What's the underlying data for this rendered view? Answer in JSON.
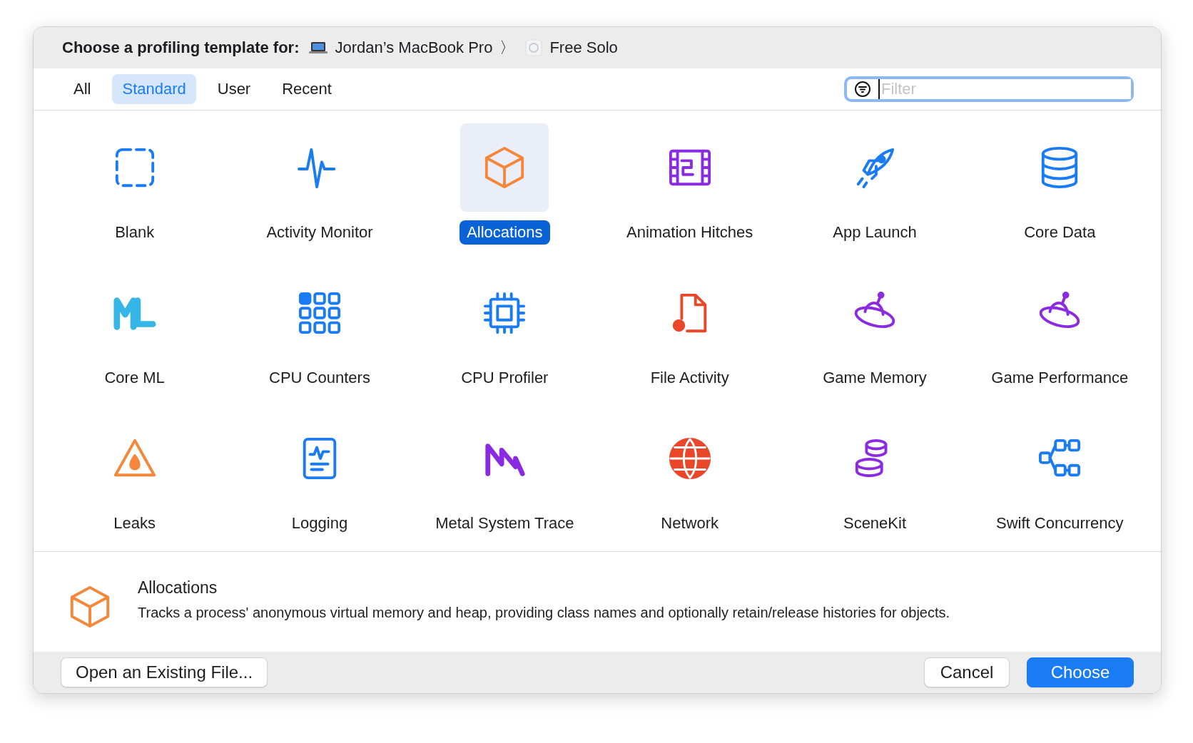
{
  "header": {
    "title": "Choose a profiling template for:",
    "device": "Jordan’s MacBook Pro",
    "separator": "〉",
    "app": "Free Solo"
  },
  "tabs": [
    {
      "label": "All",
      "selected": false
    },
    {
      "label": "Standard",
      "selected": true
    },
    {
      "label": "User",
      "selected": false
    },
    {
      "label": "Recent",
      "selected": false
    }
  ],
  "filter": {
    "placeholder": "Filter"
  },
  "templates": [
    {
      "label": "Blank",
      "kind": "blank",
      "color": "#1a7cf5",
      "selected": false
    },
    {
      "label": "Activity Monitor",
      "kind": "pulse",
      "color": "#1a7cf5",
      "selected": false
    },
    {
      "label": "Allocations",
      "kind": "cube",
      "color": "#f5873a",
      "selected": true
    },
    {
      "label": "Animation Hitches",
      "kind": "film",
      "color": "#8a2be2",
      "selected": false
    },
    {
      "label": "App Launch",
      "kind": "rocket",
      "color": "#1a7cf5",
      "selected": false
    },
    {
      "label": "Core Data",
      "kind": "database",
      "color": "#1a7cf5",
      "selected": false
    },
    {
      "label": "Core ML",
      "kind": "ml",
      "color": "#35b6e6",
      "selected": false
    },
    {
      "label": "CPU Counters",
      "kind": "grid",
      "color": "#1a7cf5",
      "selected": false
    },
    {
      "label": "CPU Profiler",
      "kind": "chip",
      "color": "#1a7cf5",
      "selected": false
    },
    {
      "label": "File Activity",
      "kind": "file",
      "color": "#e9462a",
      "selected": false
    },
    {
      "label": "Game Memory",
      "kind": "ufo",
      "color": "#8a2be2",
      "selected": false
    },
    {
      "label": "Game Performance",
      "kind": "ufo",
      "color": "#8a2be2",
      "selected": false
    },
    {
      "label": "Leaks",
      "kind": "drop",
      "color": "#f5873a",
      "selected": false
    },
    {
      "label": "Logging",
      "kind": "log",
      "color": "#1a7cf5",
      "selected": false
    },
    {
      "label": "Metal System Trace",
      "kind": "metal",
      "color": "#8a2be2",
      "selected": false
    },
    {
      "label": "Network",
      "kind": "globe",
      "color": "#e9462a",
      "selected": false
    },
    {
      "label": "SceneKit",
      "kind": "stack",
      "color": "#8a2be2",
      "selected": false
    },
    {
      "label": "Swift Concurrency",
      "kind": "nodes",
      "color": "#1a7cf5",
      "selected": false
    }
  ],
  "detail": {
    "title": "Allocations",
    "description": "Tracks a process' anonymous virtual memory and heap, providing class names and optionally retain/release histories for objects."
  },
  "buttons": {
    "open": "Open an Existing File...",
    "cancel": "Cancel",
    "choose": "Choose"
  }
}
